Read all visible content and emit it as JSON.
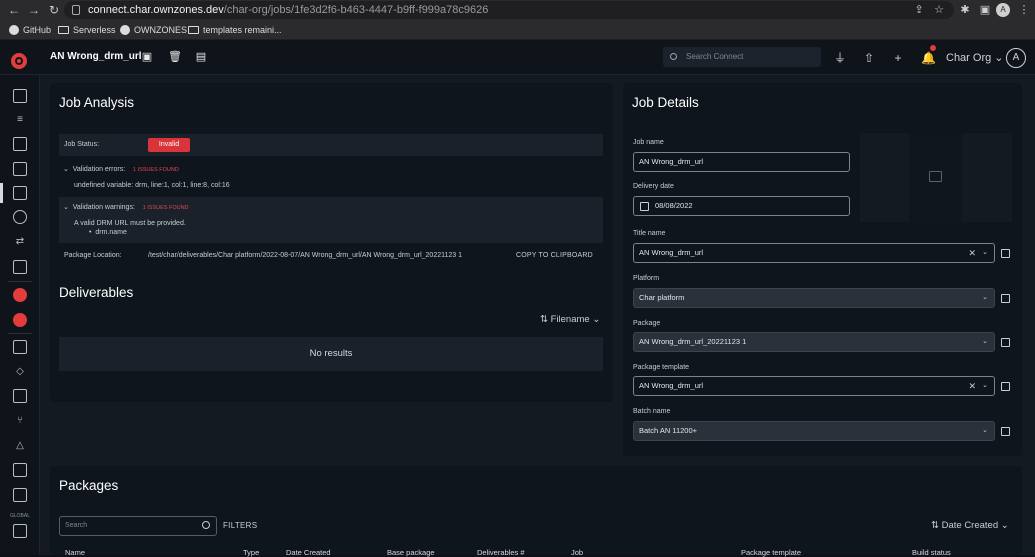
{
  "browser": {
    "url_host": "connect.char.ownzones.dev",
    "url_path": "/char-org/jobs/1fe3d2f6-b463-4447-b9ff-f999a78c9626",
    "bookmarks": [
      "GitHub",
      "Serverless",
      "OWNZONES",
      "templates remaini..."
    ]
  },
  "app": {
    "job_title": "AN Wrong_drm_url",
    "search_placeholder": "Search Connect",
    "org": "Char Org",
    "avatar_initial": "A",
    "brand_color": "#e23c3c"
  },
  "sidebar": {
    "global_label": "GLOBAL"
  },
  "analysis": {
    "title": "Job Analysis",
    "status_label": "Job Status:",
    "status_value": "Invalid",
    "errors_label": "Validation errors:",
    "errors_count": "1 ISSUES FOUND",
    "errors_detail": "undefined variable: drm, line:1, col:1, line:8, col:16",
    "warnings_label": "Validation warnings:",
    "warnings_count": "1 ISSUES FOUND",
    "warnings_detail": "A valid DRM URL must be provided.",
    "warnings_item": "drm.name",
    "package_location_label": "Package Location:",
    "package_location_value": "/test/char/deliverables/Char platform/2022-08-07/AN Wrong_drm_url/AN Wrong_drm_url_20221123 1",
    "copy_label": "COPY TO CLIPBOARD"
  },
  "deliverables": {
    "title": "Deliverables",
    "sort_label": "Filename",
    "empty_text": "No results"
  },
  "details": {
    "title": "Job Details",
    "job_name_label": "Job name",
    "job_name_value": "AN Wrong_drm_url",
    "delivery_date_label": "Delivery date",
    "delivery_date_value": "08/08/2022",
    "title_name_label": "Title name",
    "title_name_value": "AN Wrong_drm_url",
    "platform_label": "Platform",
    "platform_value": "Char platform",
    "package_label": "Package",
    "package_value": "AN Wrong_drm_url_20221123 1",
    "package_template_label": "Package template",
    "package_template_value": "AN Wrong_drm_url",
    "batch_name_label": "Batch name",
    "batch_name_value": "Batch AN 11200+"
  },
  "packages": {
    "title": "Packages",
    "search_placeholder": "Search",
    "filters_label": "FILTERS",
    "sort_label": "Date Created",
    "columns": [
      "Name",
      "Type",
      "Date Created",
      "Base package",
      "Deliverables #",
      "Job",
      "Package template",
      "Build status"
    ]
  }
}
